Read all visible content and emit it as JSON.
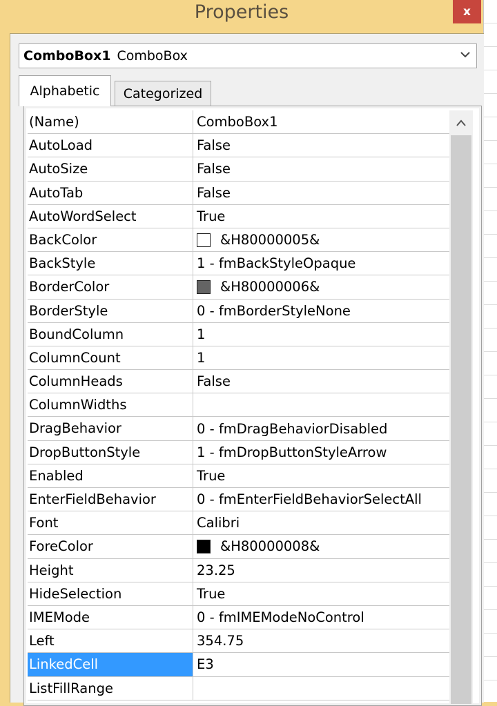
{
  "window": {
    "title": "Properties",
    "close_label": "x"
  },
  "object_selector": {
    "name": "ComboBox1",
    "type": "ComboBox"
  },
  "tabs": [
    {
      "label": "Alphabetic",
      "active": true
    },
    {
      "label": "Categorized",
      "active": false
    }
  ],
  "properties": [
    {
      "name": "(Name)",
      "value": "ComboBox1"
    },
    {
      "name": "AutoLoad",
      "value": "False"
    },
    {
      "name": "AutoSize",
      "value": "False"
    },
    {
      "name": "AutoTab",
      "value": "False"
    },
    {
      "name": "AutoWordSelect",
      "value": "True"
    },
    {
      "name": "BackColor",
      "value": "&H80000005&",
      "swatch": "#ffffff"
    },
    {
      "name": "BackStyle",
      "value": "1 - fmBackStyleOpaque"
    },
    {
      "name": "BorderColor",
      "value": "&H80000006&",
      "swatch": "#646464"
    },
    {
      "name": "BorderStyle",
      "value": "0 - fmBorderStyleNone"
    },
    {
      "name": "BoundColumn",
      "value": "1"
    },
    {
      "name": "ColumnCount",
      "value": "1"
    },
    {
      "name": "ColumnHeads",
      "value": "False"
    },
    {
      "name": "ColumnWidths",
      "value": ""
    },
    {
      "name": "DragBehavior",
      "value": "0 - fmDragBehaviorDisabled"
    },
    {
      "name": "DropButtonStyle",
      "value": "1 - fmDropButtonStyleArrow"
    },
    {
      "name": "Enabled",
      "value": "True"
    },
    {
      "name": "EnterFieldBehavior",
      "value": "0 - fmEnterFieldBehaviorSelectAll"
    },
    {
      "name": "Font",
      "value": "Calibri"
    },
    {
      "name": "ForeColor",
      "value": "&H80000008&",
      "swatch": "#000000"
    },
    {
      "name": "Height",
      "value": "23.25"
    },
    {
      "name": "HideSelection",
      "value": "True"
    },
    {
      "name": "IMEMode",
      "value": "0 - fmIMEModeNoControl"
    },
    {
      "name": "Left",
      "value": "354.75"
    },
    {
      "name": "LinkedCell",
      "value": "E3",
      "selected": true
    },
    {
      "name": "ListFillRange",
      "value": ""
    }
  ],
  "colors": {
    "selection": "#3399ff",
    "title_bar": "#f5d68a",
    "close": "#c7463d"
  }
}
